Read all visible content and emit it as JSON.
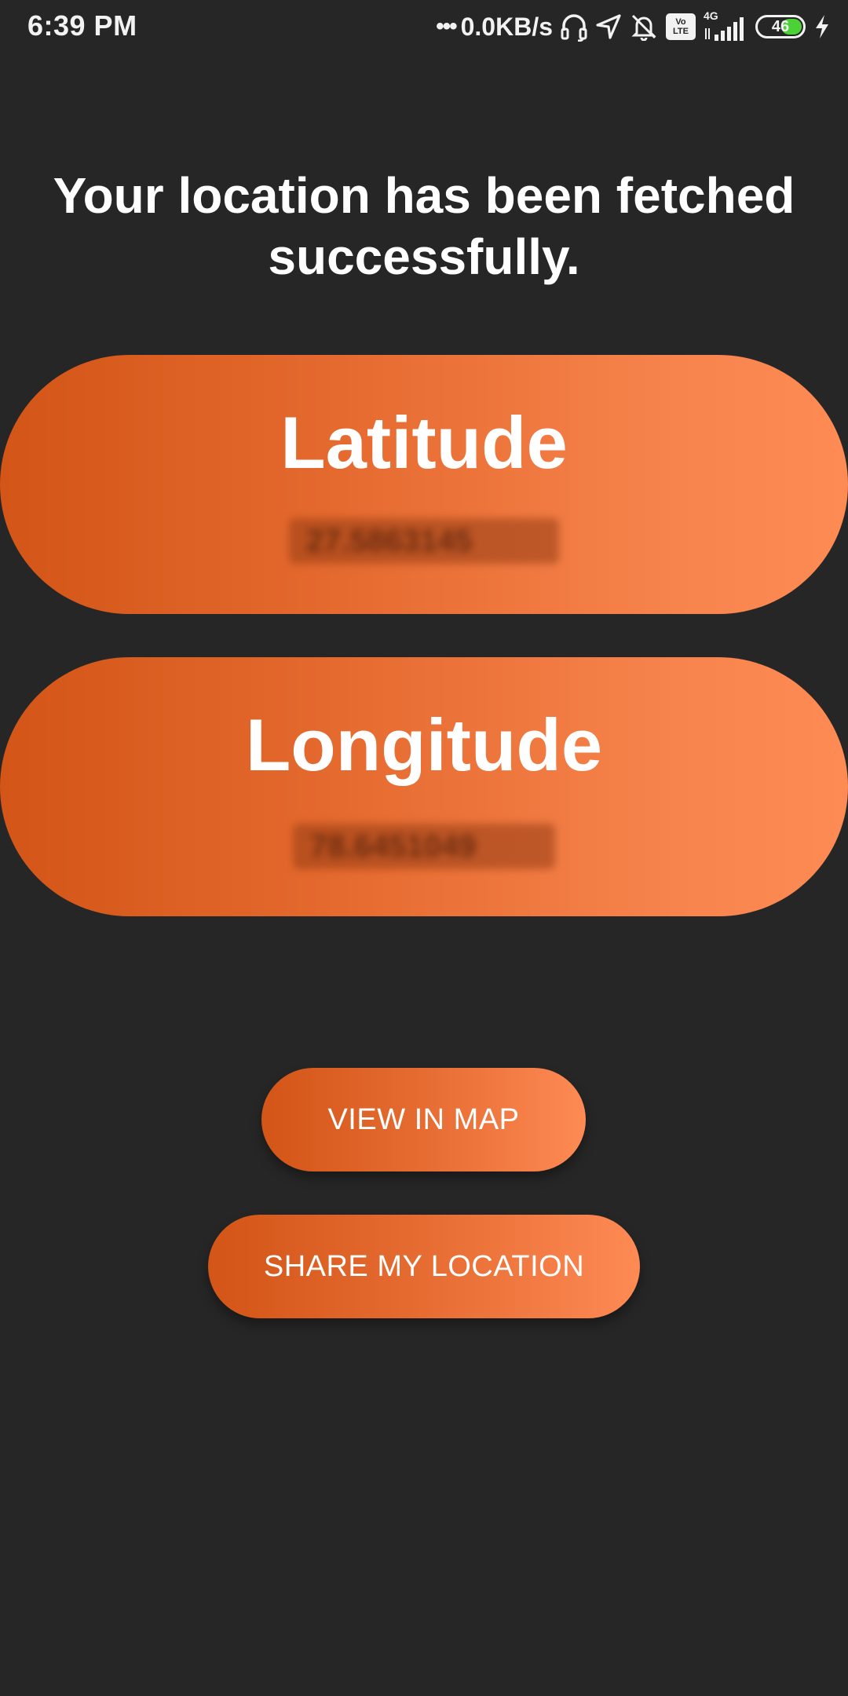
{
  "status_bar": {
    "time": "6:39 PM",
    "dots": "•••",
    "net_speed": "0.0KB/s",
    "volte_top": "Vo",
    "volte_bottom": "LTE",
    "network_type": "4G",
    "battery_level": "46",
    "battery_color": "#4cd137",
    "icons": [
      "headset-icon",
      "location-arrow-icon",
      "bell-muted-icon",
      "volte-icon",
      "signal-icon",
      "battery-icon",
      "charging-bolt-icon"
    ]
  },
  "headline": "Your location has been fetched successfully.",
  "latitude": {
    "title": "Latitude",
    "value": "27.5863145"
  },
  "longitude": {
    "title": "Longitude",
    "value": "78.6451049"
  },
  "buttons": {
    "view_map": "VIEW IN MAP",
    "share": "SHARE MY LOCATION"
  },
  "colors": {
    "background": "#262626",
    "gradient_start": "#d35517",
    "gradient_end": "#fe8a54",
    "text": "#ffffff"
  }
}
